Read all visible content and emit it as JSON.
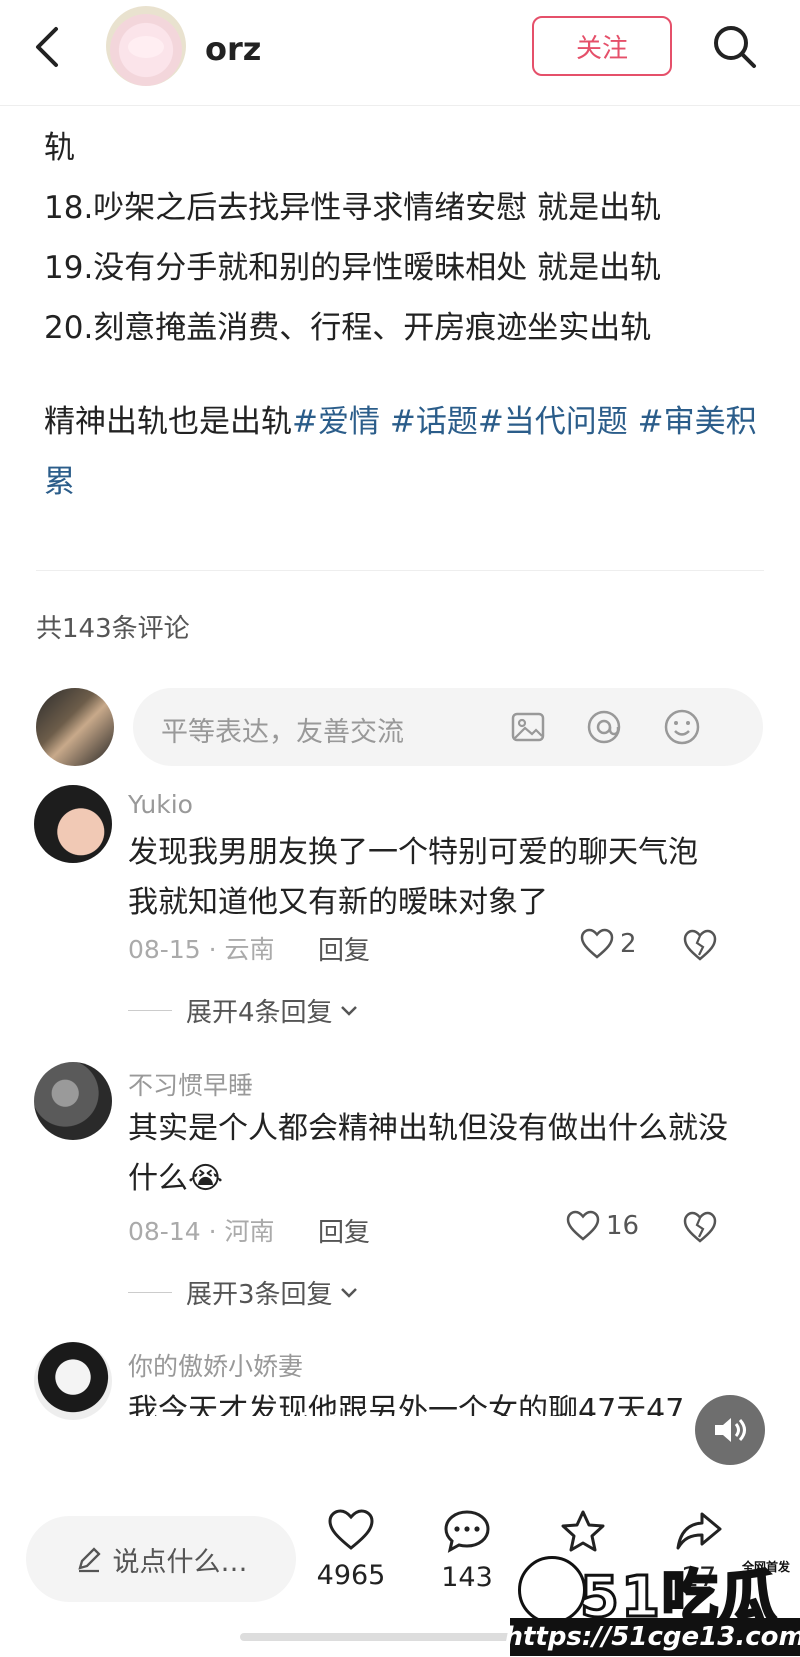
{
  "header": {
    "username": "orz",
    "follow_label": "关注"
  },
  "post": {
    "lines": [
      "轨",
      "18.吵架之后去找异性寻求情绪安慰 就是出轨",
      "19.没有分手就和别的异性暧昧相处 就是出轨",
      "20.刻意掩盖消费、行程、开房痕迹坐实出轨"
    ],
    "closing_text": "精神出轨也是出轨",
    "tags": [
      "#爱情",
      "#话题",
      "#当代问题",
      "#审美积累"
    ]
  },
  "comments_section": {
    "count_label": "共143条评论",
    "input_placeholder": "平等表达，友善交流",
    "comments": [
      {
        "name": "Yukio",
        "text": "发现我男朋友换了一个特别可爱的聊天气泡 我就知道他又有新的暧昧对象了",
        "date": "08-15",
        "location": "云南",
        "reply_label": "回复",
        "likes": "2",
        "expand_label": "展开4条回复"
      },
      {
        "name": "不习惯早睡",
        "text": "其实是个人都会精神出轨但没有做出什么就没什么😭",
        "date": "08-14",
        "location": "河南",
        "reply_label": "回复",
        "likes": "16",
        "expand_label": "展开3条回复"
      },
      {
        "name": "你的傲娇小娇妻",
        "text": "我今天才发现他跟另外一个女的聊47天47"
      }
    ]
  },
  "bottom_bar": {
    "say_label": "说点什么…",
    "likes": "4965",
    "comments": "143",
    "shares": "27"
  },
  "watermark": {
    "logo_text": "51吃瓜",
    "sub_text": "全网首发",
    "url": "https://51cge13.com"
  },
  "colors": {
    "accent": "#e5506a",
    "tag": "#2b5d8a"
  }
}
